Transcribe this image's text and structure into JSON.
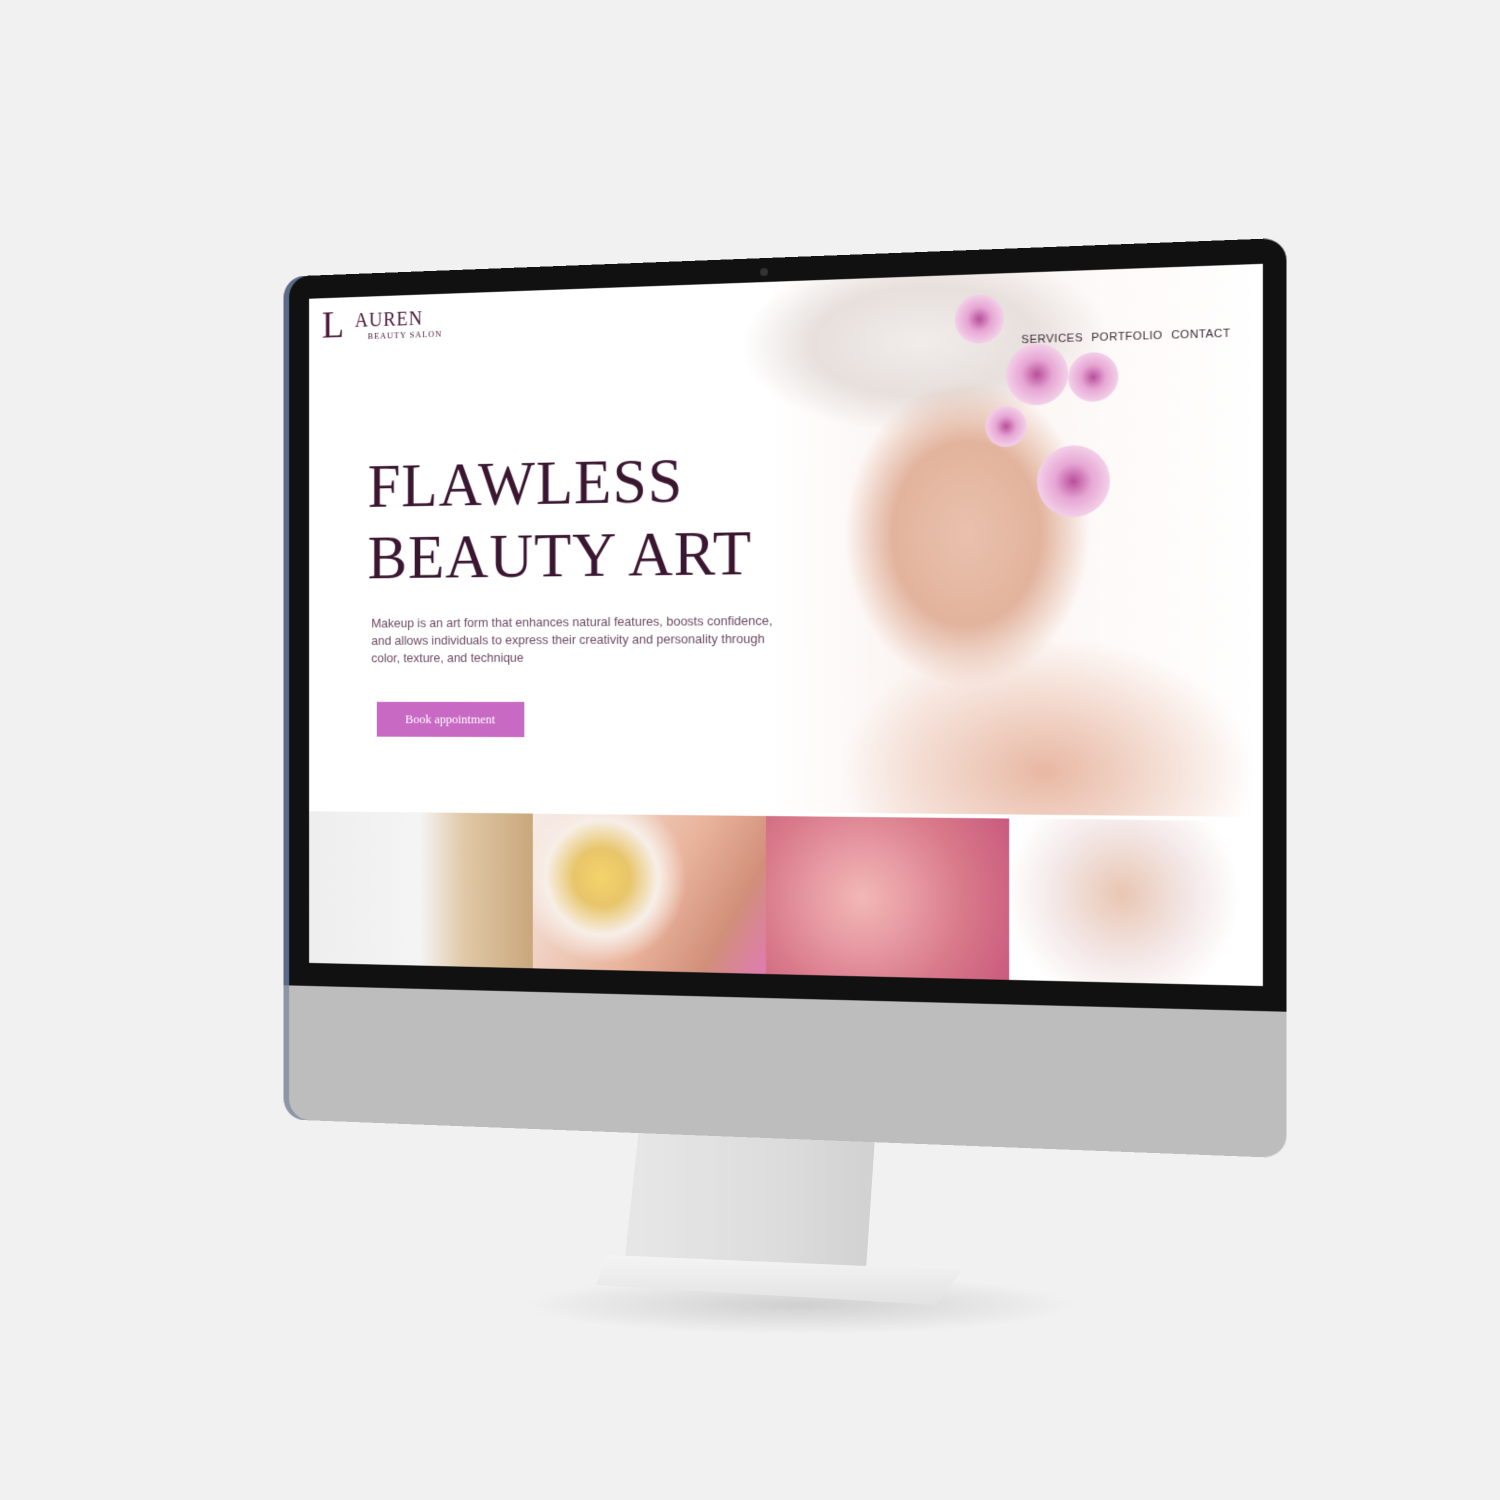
{
  "site": {
    "logo_mark": "L",
    "logo_name": "AUREN",
    "logo_tagline": "BEAUTY SALON",
    "nav": [
      {
        "label": "SERVICES"
      },
      {
        "label": "PORTFOLIO"
      },
      {
        "label": "CONTACT"
      }
    ]
  },
  "hero": {
    "headline_line1": "FLAWLESS",
    "headline_line2": "BEAUTY ART",
    "description": "Makeup is an art form that enhances natural features, boosts confidence, and allows individuals to express their creativity and personality through color, texture, and technique",
    "cta_label": "Book appointment"
  },
  "colors": {
    "brand_dark": "#3a1630",
    "accent": "#c869c3",
    "monitor_bezel": "#111111",
    "monitor_chin": "#bdbdbd"
  }
}
